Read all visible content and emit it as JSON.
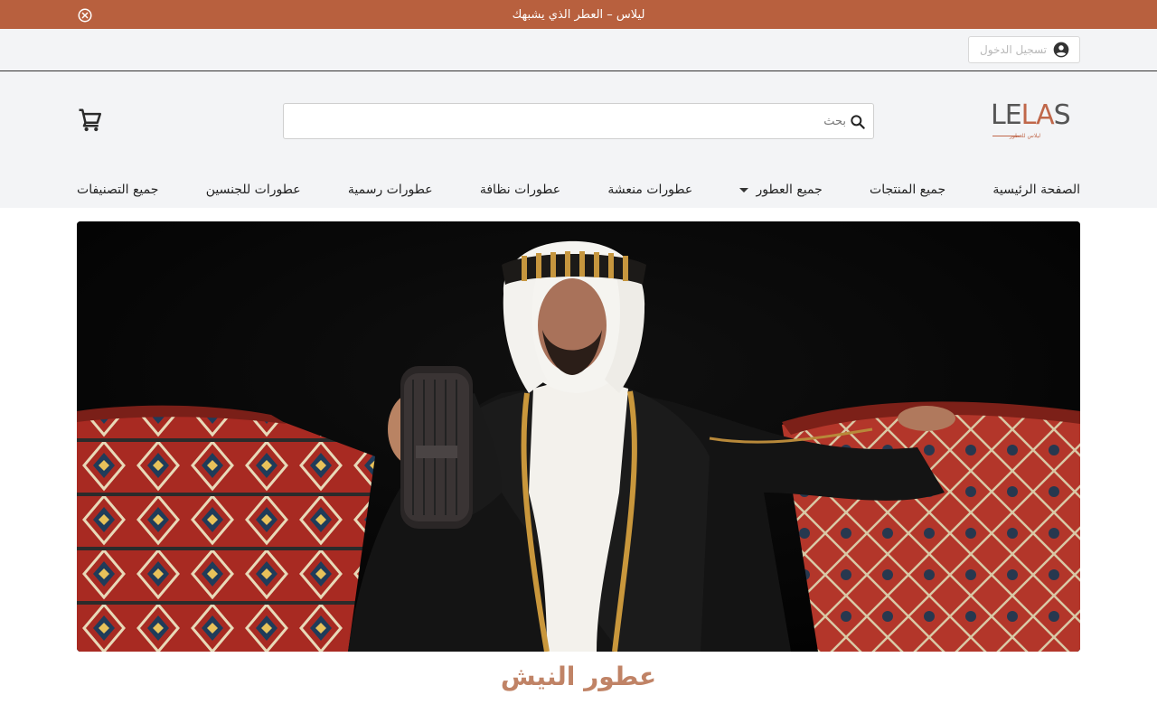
{
  "announcement": {
    "text": "ليلاس – العطر الذي يشبهك"
  },
  "utility": {
    "login_label": "تسجيل الدخول"
  },
  "brand": {
    "logo_text": "LELAS",
    "logo_tagline": "ليلاس للعطور"
  },
  "search": {
    "placeholder": "بحث",
    "value": ""
  },
  "nav": {
    "items": [
      {
        "label": "الصفحة الرئيسية"
      },
      {
        "label": "جميع المنتجات"
      },
      {
        "label": "جميع العطور",
        "has_dropdown": true
      },
      {
        "label": "عطورات منعشة"
      },
      {
        "label": "عطورات نظافة"
      },
      {
        "label": "عطورات رسمية"
      },
      {
        "label": "عطورات للجنسين"
      },
      {
        "label": "جميع التصنيفات"
      }
    ]
  },
  "hero": {
    "image_alt": "رجل يرتدي الشماغ والعقال يحمل عبوة عطر ليلاس جالساً على أريكة بنقوش تقليدية"
  },
  "section": {
    "title": "عطور النيش"
  },
  "colors": {
    "accent": "#b8603e",
    "title": "#c08366",
    "header_bg": "#f3f4f6"
  },
  "icons": [
    "close-circle-icon",
    "account-circle-icon",
    "search-icon",
    "cart-icon",
    "chevron-down-icon"
  ]
}
